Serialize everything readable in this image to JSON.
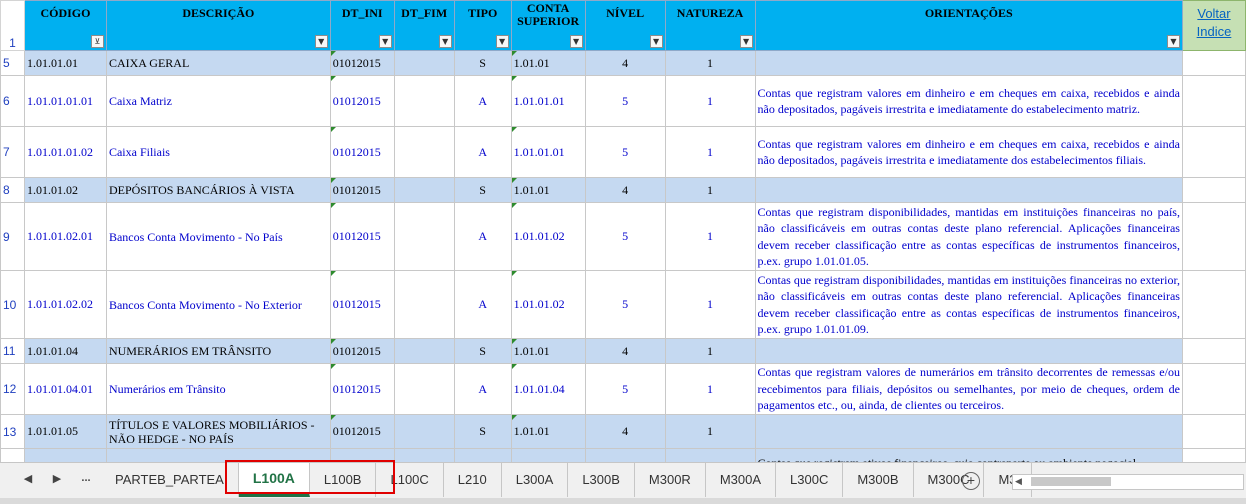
{
  "header": {
    "row_number": "1",
    "codigo": "CÓDIGO",
    "descricao": "DESCRIÇÃO",
    "dt_ini": "DT_INI",
    "dt_fim": "DT_FIM",
    "tipo": "TIPO",
    "conta_superior_1": "CONTA",
    "conta_superior_2": "SUPERIOR",
    "nivel": "NÍVEL",
    "natureza": "NATUREZA",
    "orientacoes": "ORIENTAÇÕES",
    "voltar_1": "Voltar",
    "voltar_2": "Indice",
    "filter_glyph": "▼",
    "filter_active_glyph": "⊻"
  },
  "rows": [
    {
      "rn": "5",
      "codigo": "1.01.01.01",
      "descricao": "CAIXA GERAL",
      "dt_ini": "01012015",
      "dt_fim": "",
      "tipo": "S",
      "conta_superior": "1.01.01",
      "nivel": "4",
      "natureza": "1",
      "orientacoes": ""
    },
    {
      "rn": "6",
      "codigo": "1.01.01.01.01",
      "descricao": "Caixa Matriz",
      "dt_ini": "01012015",
      "dt_fim": "",
      "tipo": "A",
      "conta_superior": "1.01.01.01",
      "nivel": "5",
      "natureza": "1",
      "orientacoes": "Contas que registram valores em dinheiro e em cheques em caixa, recebidos e ainda não depositados, pagáveis irrestrita e imediatamente do estabelecimento matriz."
    },
    {
      "rn": "7",
      "codigo": "1.01.01.01.02",
      "descricao": "Caixa Filiais",
      "dt_ini": "01012015",
      "dt_fim": "",
      "tipo": "A",
      "conta_superior": "1.01.01.01",
      "nivel": "5",
      "natureza": "1",
      "orientacoes": "Contas que registram valores em dinheiro e em cheques em caixa, recebidos e ainda não depositados, pagáveis irrestrita e imediatamente dos estabelecimentos filiais."
    },
    {
      "rn": "8",
      "codigo": "1.01.01.02",
      "descricao": "DEPÓSITOS BANCÁRIOS À VISTA",
      "dt_ini": "01012015",
      "dt_fim": "",
      "tipo": "S",
      "conta_superior": "1.01.01",
      "nivel": "4",
      "natureza": "1",
      "orientacoes": ""
    },
    {
      "rn": "9",
      "codigo": "1.01.01.02.01",
      "descricao": "Bancos Conta Movimento - No País",
      "dt_ini": "01012015",
      "dt_fim": "",
      "tipo": "A",
      "conta_superior": "1.01.01.02",
      "nivel": "5",
      "natureza": "1",
      "orientacoes": "Contas que registram disponibilidades, mantidas em instituições financeiras no país, não classificáveis em outras contas deste plano referencial. Aplicações financeiras devem receber classificação entre as contas específicas de instrumentos financeiros, p.ex. grupo 1.01.01.05."
    },
    {
      "rn": "10",
      "codigo": "1.01.01.02.02",
      "descricao": "Bancos Conta Movimento - No Exterior",
      "dt_ini": "01012015",
      "dt_fim": "",
      "tipo": "A",
      "conta_superior": "1.01.01.02",
      "nivel": "5",
      "natureza": "1",
      "orientacoes": "Contas que registram disponibilidades, mantidas em instituições financeiras no exterior, não classificáveis em outras contas deste plano referencial. Aplicações financeiras devem receber classificação entre as contas específicas de instrumentos financeiros, p.ex. grupo 1.01.01.09."
    },
    {
      "rn": "11",
      "codigo": "1.01.01.04",
      "descricao": "NUMERÁRIOS EM TRÂNSITO",
      "dt_ini": "01012015",
      "dt_fim": "",
      "tipo": "S",
      "conta_superior": "1.01.01",
      "nivel": "4",
      "natureza": "1",
      "orientacoes": ""
    },
    {
      "rn": "12",
      "codigo": "1.01.01.04.01",
      "descricao": "Numerários em Trânsito",
      "dt_ini": "01012015",
      "dt_fim": "",
      "tipo": "A",
      "conta_superior": "1.01.01.04",
      "nivel": "5",
      "natureza": "1",
      "orientacoes": "Contas que registram valores de numerários em trânsito decorrentes de remessas e/ou recebimentos para filiais, depósitos ou semelhantes, por meio de cheques, ordem de pagamentos etc., ou, ainda, de clientes ou terceiros."
    },
    {
      "rn": "13",
      "codigo": "1.01.01.05",
      "descricao": "TÍTULOS E VALORES MOBILIÁRIOS - NÃO HEDGE - NO PAÍS",
      "dt_ini": "01012015",
      "dt_fim": "",
      "tipo": "S",
      "conta_superior": "1.01.01",
      "nivel": "4",
      "natureza": "1",
      "orientacoes": ""
    },
    {
      "rn": "",
      "codigo": "",
      "descricao": "",
      "dt_ini": "",
      "dt_fim": "",
      "tipo": "",
      "conta_superior": "",
      "nivel": "",
      "natureza": "",
      "orientacoes": "Contas que registram ativos financeiros, cuja contraparte ou ambiente negocial"
    }
  ],
  "tabbar": {
    "prev": "◀",
    "next": "▶",
    "more": "...",
    "add": "+",
    "scroll_left": "◀",
    "tabs": [
      "PARTEB_PARTEA",
      "L100A",
      "L100B",
      "L100C",
      "L210",
      "L300A",
      "L300B",
      "M300R",
      "M300A",
      "L300C",
      "M300B",
      "M300C",
      "M3"
    ],
    "active_tab": "L100A"
  }
}
